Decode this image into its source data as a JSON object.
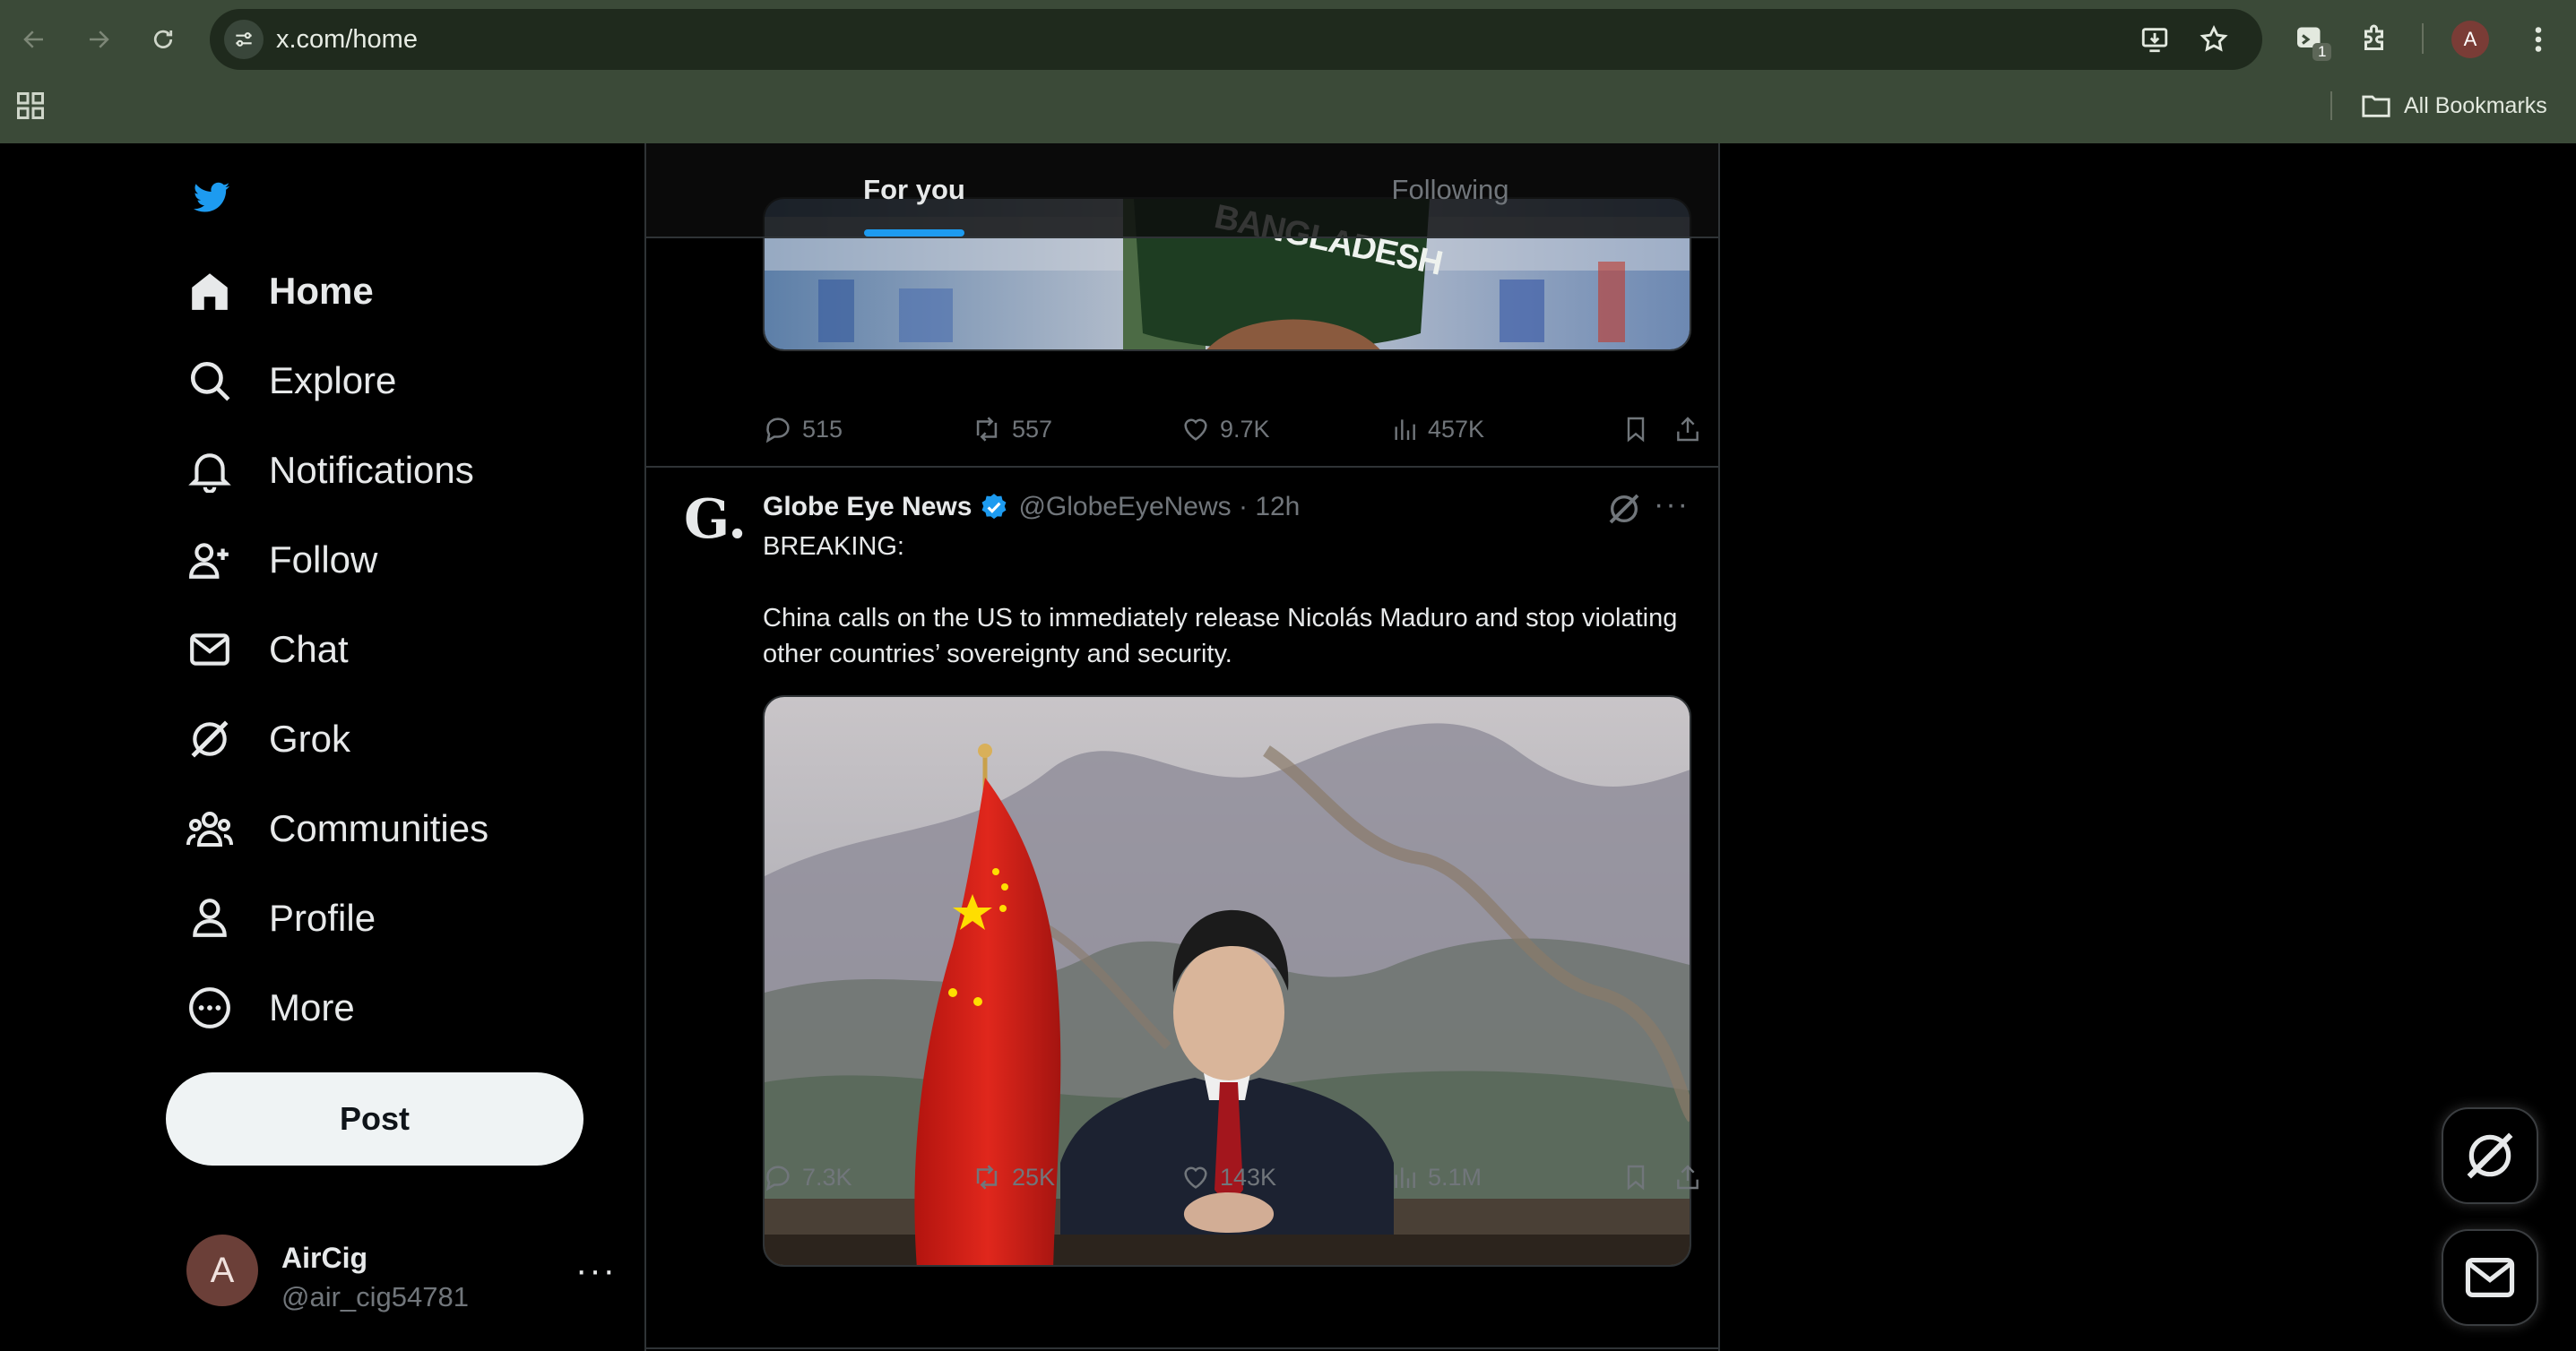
{
  "browser": {
    "url": "x.com/home",
    "extension_badge": "1",
    "profile_initial": "A",
    "bookmarks_label": "All Bookmarks"
  },
  "sidebar": {
    "items": [
      {
        "label": "Home",
        "icon": "home-icon"
      },
      {
        "label": "Explore",
        "icon": "search-icon"
      },
      {
        "label": "Notifications",
        "icon": "bell-icon"
      },
      {
        "label": "Follow",
        "icon": "follow-icon"
      },
      {
        "label": "Chat",
        "icon": "mail-icon"
      },
      {
        "label": "Grok",
        "icon": "grok-icon"
      },
      {
        "label": "Communities",
        "icon": "communities-icon"
      },
      {
        "label": "Profile",
        "icon": "profile-icon"
      },
      {
        "label": "More",
        "icon": "more-circle-icon"
      }
    ],
    "post_label": "Post",
    "account": {
      "initial": "A",
      "name": "AirCig",
      "handle": "@air_cig54781",
      "more": "···"
    }
  },
  "feed": {
    "tabs": [
      {
        "label": "For you",
        "active": true
      },
      {
        "label": "Following",
        "active": false
      }
    ],
    "previous_tweet": {
      "image_text": "BANGLADESH",
      "replies": "515",
      "reposts": "557",
      "likes": "9.7K",
      "views": "457K"
    },
    "tweet": {
      "logo": "G.",
      "author": "Globe Eye News",
      "meta": "@GlobeEyeNews · 12h",
      "text": "BREAKING:\n\nChina calls on the US to immediately release Nicolás Maduro and stop violating other countries’ sovereignty and security.",
      "replies": "7.3K",
      "reposts": "25K",
      "likes": "143K",
      "views": "5.1M",
      "more": "···"
    }
  },
  "colors": {
    "accent": "#1d9bf0",
    "chrome": "#3b4a38",
    "verified": "#1d9bf0"
  }
}
